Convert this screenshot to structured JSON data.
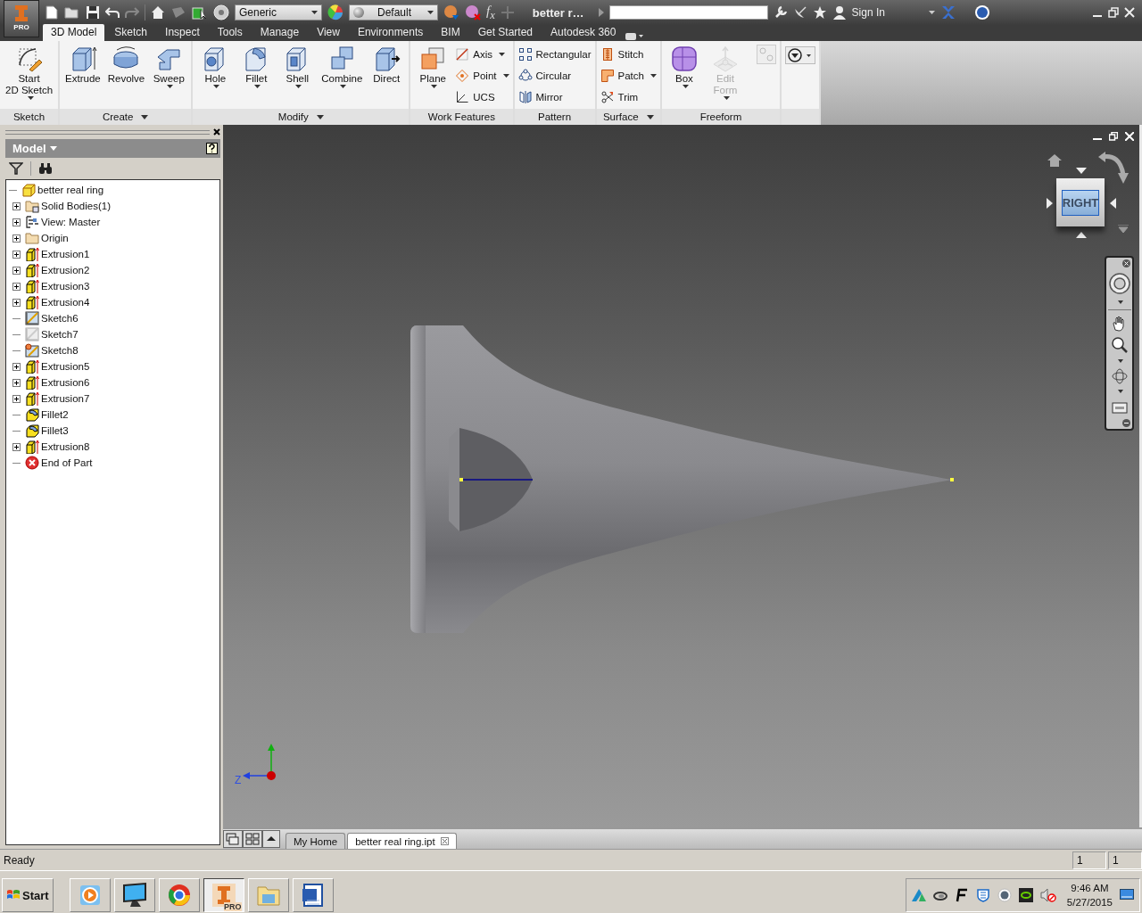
{
  "app_button": {
    "badge": "PRO"
  },
  "quick_access": {
    "material": "Generic",
    "appearance": "Default",
    "function_symbol": "f$_{x}$",
    "title": "better r…",
    "sign_in": "Sign In"
  },
  "tabs": [
    {
      "label": "3D Model",
      "selected": true
    },
    {
      "label": "Sketch",
      "selected": false
    },
    {
      "label": "Inspect",
      "selected": false
    },
    {
      "label": "Tools",
      "selected": false
    },
    {
      "label": "Manage",
      "selected": false
    },
    {
      "label": "View",
      "selected": false
    },
    {
      "label": "Environments",
      "selected": false
    },
    {
      "label": "BIM",
      "selected": false
    },
    {
      "label": "Get Started",
      "selected": false
    },
    {
      "label": "Autodesk 360",
      "selected": false
    }
  ],
  "ribbon": {
    "panels": [
      {
        "title": "Sketch",
        "has_menu": false,
        "tools": [
          {
            "label": "Start\n2D Sketch",
            "kind": "large",
            "has_menu": true,
            "disabled": false
          }
        ]
      },
      {
        "title": "Create",
        "has_menu": true,
        "tools": [
          {
            "label": "Extrude",
            "kind": "large",
            "has_menu": false,
            "disabled": false
          },
          {
            "label": "Revolve",
            "kind": "large",
            "has_menu": false,
            "disabled": false
          },
          {
            "label": "Sweep",
            "kind": "large",
            "has_menu": true,
            "disabled": false
          }
        ]
      },
      {
        "title": "Modify",
        "has_menu": true,
        "tools": [
          {
            "label": "Hole",
            "kind": "large",
            "has_menu": true,
            "disabled": false
          },
          {
            "label": "Fillet",
            "kind": "large",
            "has_menu": true,
            "disabled": false
          },
          {
            "label": "Shell",
            "kind": "large",
            "has_menu": true,
            "disabled": false
          },
          {
            "label": "Combine",
            "kind": "large",
            "has_menu": true,
            "disabled": false
          },
          {
            "label": "Direct",
            "kind": "large",
            "has_menu": false,
            "disabled": false
          }
        ]
      },
      {
        "title": "Work Features",
        "has_menu": false,
        "tools": [
          {
            "label": "Plane",
            "kind": "large",
            "has_menu": true,
            "disabled": false
          },
          {
            "label": "Axis",
            "kind": "small",
            "has_menu": true,
            "disabled": false
          },
          {
            "label": "Point",
            "kind": "small",
            "has_menu": true,
            "disabled": false
          },
          {
            "label": "UCS",
            "kind": "small",
            "has_menu": false,
            "disabled": false
          }
        ]
      },
      {
        "title": "Pattern",
        "has_menu": false,
        "tools": [
          {
            "label": "Rectangular",
            "kind": "small",
            "has_menu": false,
            "disabled": false
          },
          {
            "label": "Circular",
            "kind": "small",
            "has_menu": false,
            "disabled": false
          },
          {
            "label": "Mirror",
            "kind": "small",
            "has_menu": false,
            "disabled": false
          }
        ]
      },
      {
        "title": "Surface",
        "has_menu": true,
        "tools": [
          {
            "label": "Stitch",
            "kind": "small",
            "has_menu": false,
            "disabled": false
          },
          {
            "label": "Patch",
            "kind": "small",
            "has_menu": true,
            "disabled": false
          },
          {
            "label": "Trim",
            "kind": "small",
            "has_menu": false,
            "disabled": false
          }
        ]
      },
      {
        "title": "Freeform",
        "has_menu": false,
        "tools": [
          {
            "label": "Box",
            "kind": "large",
            "has_menu": true,
            "disabled": false
          },
          {
            "label": "Edit\nForm",
            "kind": "large",
            "has_menu": true,
            "disabled": true
          }
        ]
      }
    ]
  },
  "browser": {
    "title": "Model",
    "tree": [
      {
        "label": "better real ring",
        "kind": "part",
        "expandable": false,
        "children": [
          {
            "label": "Solid Bodies(1)",
            "kind": "bodies",
            "expandable": true
          },
          {
            "label": "View: Master",
            "kind": "view",
            "expandable": true
          },
          {
            "label": "Origin",
            "kind": "folder",
            "expandable": true
          },
          {
            "label": "Extrusion1",
            "kind": "extrusion",
            "expandable": true
          },
          {
            "label": "Extrusion2",
            "kind": "extrusion",
            "expandable": true
          },
          {
            "label": "Extrusion3",
            "kind": "extrusion",
            "expandable": true
          },
          {
            "label": "Extrusion4",
            "kind": "extrusion",
            "expandable": true
          },
          {
            "label": "Sketch6",
            "kind": "sketch",
            "expandable": false
          },
          {
            "label": "Sketch7",
            "kind": "sketch_hidden",
            "expandable": false
          },
          {
            "label": "Sketch8",
            "kind": "sketch_shared",
            "expandable": false
          },
          {
            "label": "Extrusion5",
            "kind": "extrusion",
            "expandable": true
          },
          {
            "label": "Extrusion6",
            "kind": "extrusion",
            "expandable": true
          },
          {
            "label": "Extrusion7",
            "kind": "extrusion",
            "expandable": true
          },
          {
            "label": "Fillet2",
            "kind": "fillet",
            "expandable": false
          },
          {
            "label": "Fillet3",
            "kind": "fillet",
            "expandable": false
          },
          {
            "label": "Extrusion8",
            "kind": "extrusion",
            "expandable": true
          },
          {
            "label": "End of Part",
            "kind": "end",
            "expandable": false
          }
        ]
      }
    ]
  },
  "viewport": {
    "view_cube": "RIGHT",
    "axis_label": "Z"
  },
  "document_tabs": [
    {
      "label": "My Home",
      "selected": false
    },
    {
      "label": "better real ring.ipt",
      "selected": true
    }
  ],
  "status_bar": {
    "message": "Ready",
    "cells": [
      "1",
      "1"
    ]
  },
  "taskbar": {
    "start": "Start",
    "apps": [
      {
        "kind": "media",
        "selected": false
      },
      {
        "kind": "monitor",
        "selected": false
      },
      {
        "kind": "browser",
        "selected": false
      },
      {
        "kind": "inventor",
        "selected": true,
        "badge": "PRO"
      },
      {
        "kind": "folder",
        "selected": false
      },
      {
        "kind": "word",
        "selected": false
      }
    ],
    "time": "9:46 AM",
    "date": "5/27/2015"
  }
}
